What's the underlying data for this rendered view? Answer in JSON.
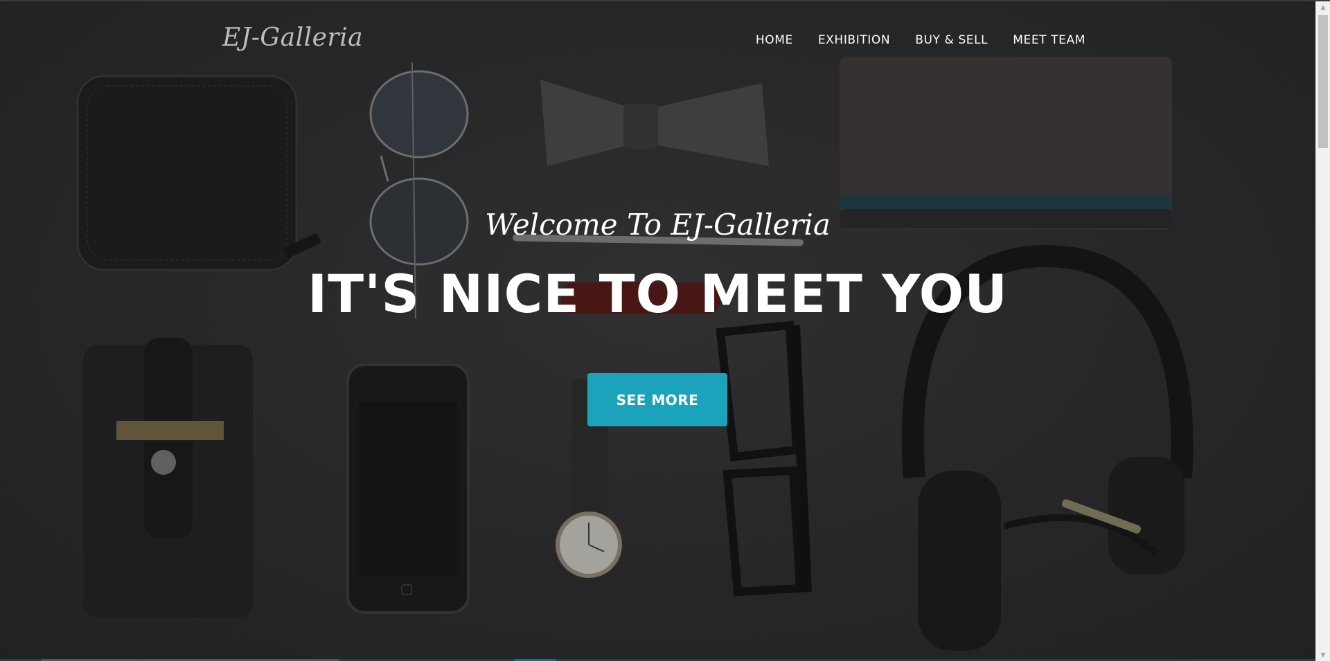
{
  "navbar": {
    "brand": "EJ-Galleria",
    "links": [
      {
        "label": "HOME"
      },
      {
        "label": "EXHIBITION"
      },
      {
        "label": "BUY & SELL"
      },
      {
        "label": "MEET TEAM"
      }
    ]
  },
  "hero": {
    "lead": "Welcome To EJ-Galleria",
    "heading": "IT'S NICE TO MEET YOU",
    "cta_label": "SEE MORE"
  },
  "colors": {
    "accent": "#1aa3bb",
    "background": "#2f2f30",
    "text": "#ffffff",
    "brand_text": "#bdbdbd"
  },
  "icons": {
    "scroll_up": "scroll-up-arrow-icon",
    "scroll_down": "scroll-down-arrow-icon"
  }
}
